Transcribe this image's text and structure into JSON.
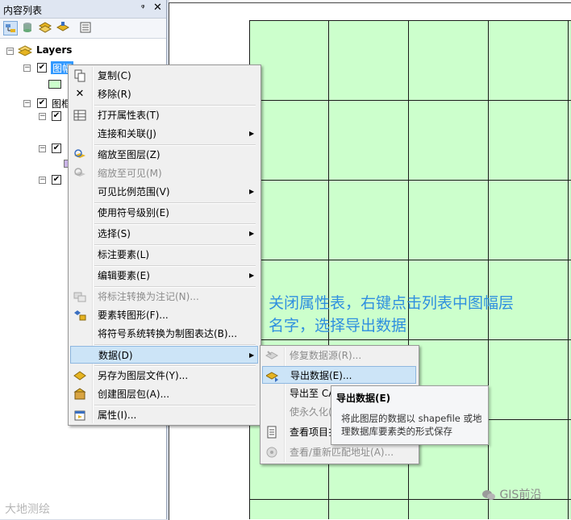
{
  "toc": {
    "title": "内容列表",
    "pin_glyph": "ᵠ",
    "close_glyph": "✕",
    "layers_label": "Layers",
    "layer1_label": "图幅",
    "layer2_label": "图框"
  },
  "context_menu": {
    "items": [
      {
        "label": "复制(C)",
        "icon": "copy-icon"
      },
      {
        "label": "移除(R)",
        "icon": "remove-icon"
      },
      {
        "label": "打开属性表(T)",
        "icon": "table-icon"
      },
      {
        "label": "连接和关联(J)",
        "icon": ""
      },
      {
        "label": "缩放至图层(Z)",
        "icon": "zoom-layer-icon"
      },
      {
        "label": "缩放至可见(M)",
        "icon": "zoom-visible-icon"
      },
      {
        "label": "可见比例范围(V)",
        "icon": ""
      },
      {
        "label": "使用符号级别(E)",
        "icon": ""
      },
      {
        "label": "选择(S)",
        "icon": ""
      },
      {
        "label": "标注要素(L)",
        "icon": ""
      },
      {
        "label": "编辑要素(E)",
        "icon": ""
      },
      {
        "label": "将标注转换为注记(N)...",
        "icon": "convert-labels-icon"
      },
      {
        "label": "要素转图形(F)...",
        "icon": "features-to-graphics-icon"
      },
      {
        "label": "将符号系统转换为制图表达(B)...",
        "icon": ""
      },
      {
        "label": "数据(D)",
        "icon": ""
      },
      {
        "label": "另存为图层文件(Y)...",
        "icon": "save-layer-icon"
      },
      {
        "label": "创建图层包(A)...",
        "icon": "layer-package-icon"
      },
      {
        "label": "属性(I)...",
        "icon": "properties-icon"
      }
    ]
  },
  "data_submenu": {
    "items": [
      {
        "label": "修复数据源(R)..."
      },
      {
        "label": "导出数据(E)..."
      },
      {
        "label": "导出至 CA"
      },
      {
        "label": "使永久化("
      },
      {
        "label": "查看项目扌"
      },
      {
        "label": "查看/重新匹配地址(A)..."
      }
    ]
  },
  "tooltip": {
    "title": "导出数据(E)",
    "body": "将此图层的数据以 shapefile 或地理数据库要素类的形式保存"
  },
  "annotation": {
    "line1": "关闭属性表，右键点击列表中图幅层",
    "line2": "名字，选择导出数据"
  },
  "watermarks": {
    "left": "大地测绘",
    "right": "GIS前沿"
  },
  "colors": {
    "grid_fill": "#ccffcc",
    "grid_line": "#1a1a1a",
    "highlight": "#cce4f7",
    "annotation": "#2f8fdf"
  }
}
